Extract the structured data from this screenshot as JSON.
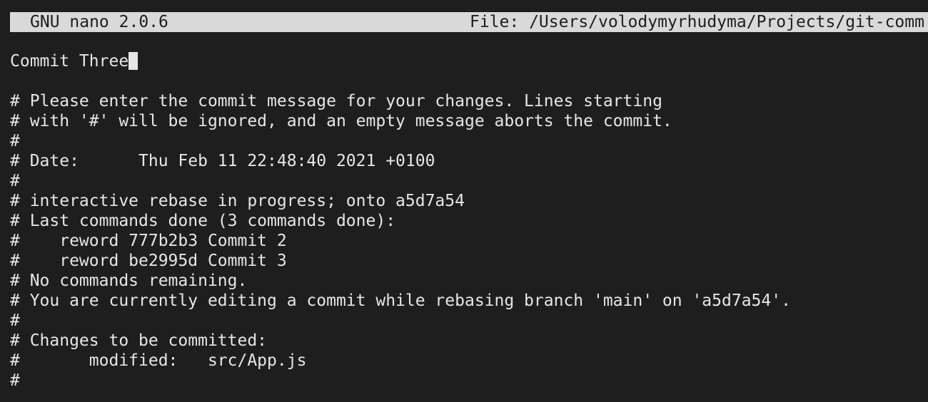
{
  "titlebar": {
    "app": "GNU nano 2.0.6",
    "file": "File: /Users/volodymyrhudyma/Projects/git-comm"
  },
  "editor": {
    "lines": [
      "Commit Three",
      "",
      "# Please enter the commit message for your changes. Lines starting",
      "# with '#' will be ignored, and an empty message aborts the commit.",
      "#",
      "# Date:      Thu Feb 11 22:48:40 2021 +0100",
      "#",
      "# interactive rebase in progress; onto a5d7a54",
      "# Last commands done (3 commands done):",
      "#    reword 777b2b3 Commit 2",
      "#    reword be2995d Commit 3",
      "# No commands remaining.",
      "# You are currently editing a commit while rebasing branch 'main' on 'a5d7a54'.",
      "#",
      "# Changes to be committed:",
      "#       modified:   src/App.js",
      "#"
    ]
  },
  "colors": {
    "background": "#1e1e1e",
    "text": "#e6e6e6",
    "titlebar_bg": "#d9d9d9",
    "titlebar_text": "#1e1e1e"
  }
}
